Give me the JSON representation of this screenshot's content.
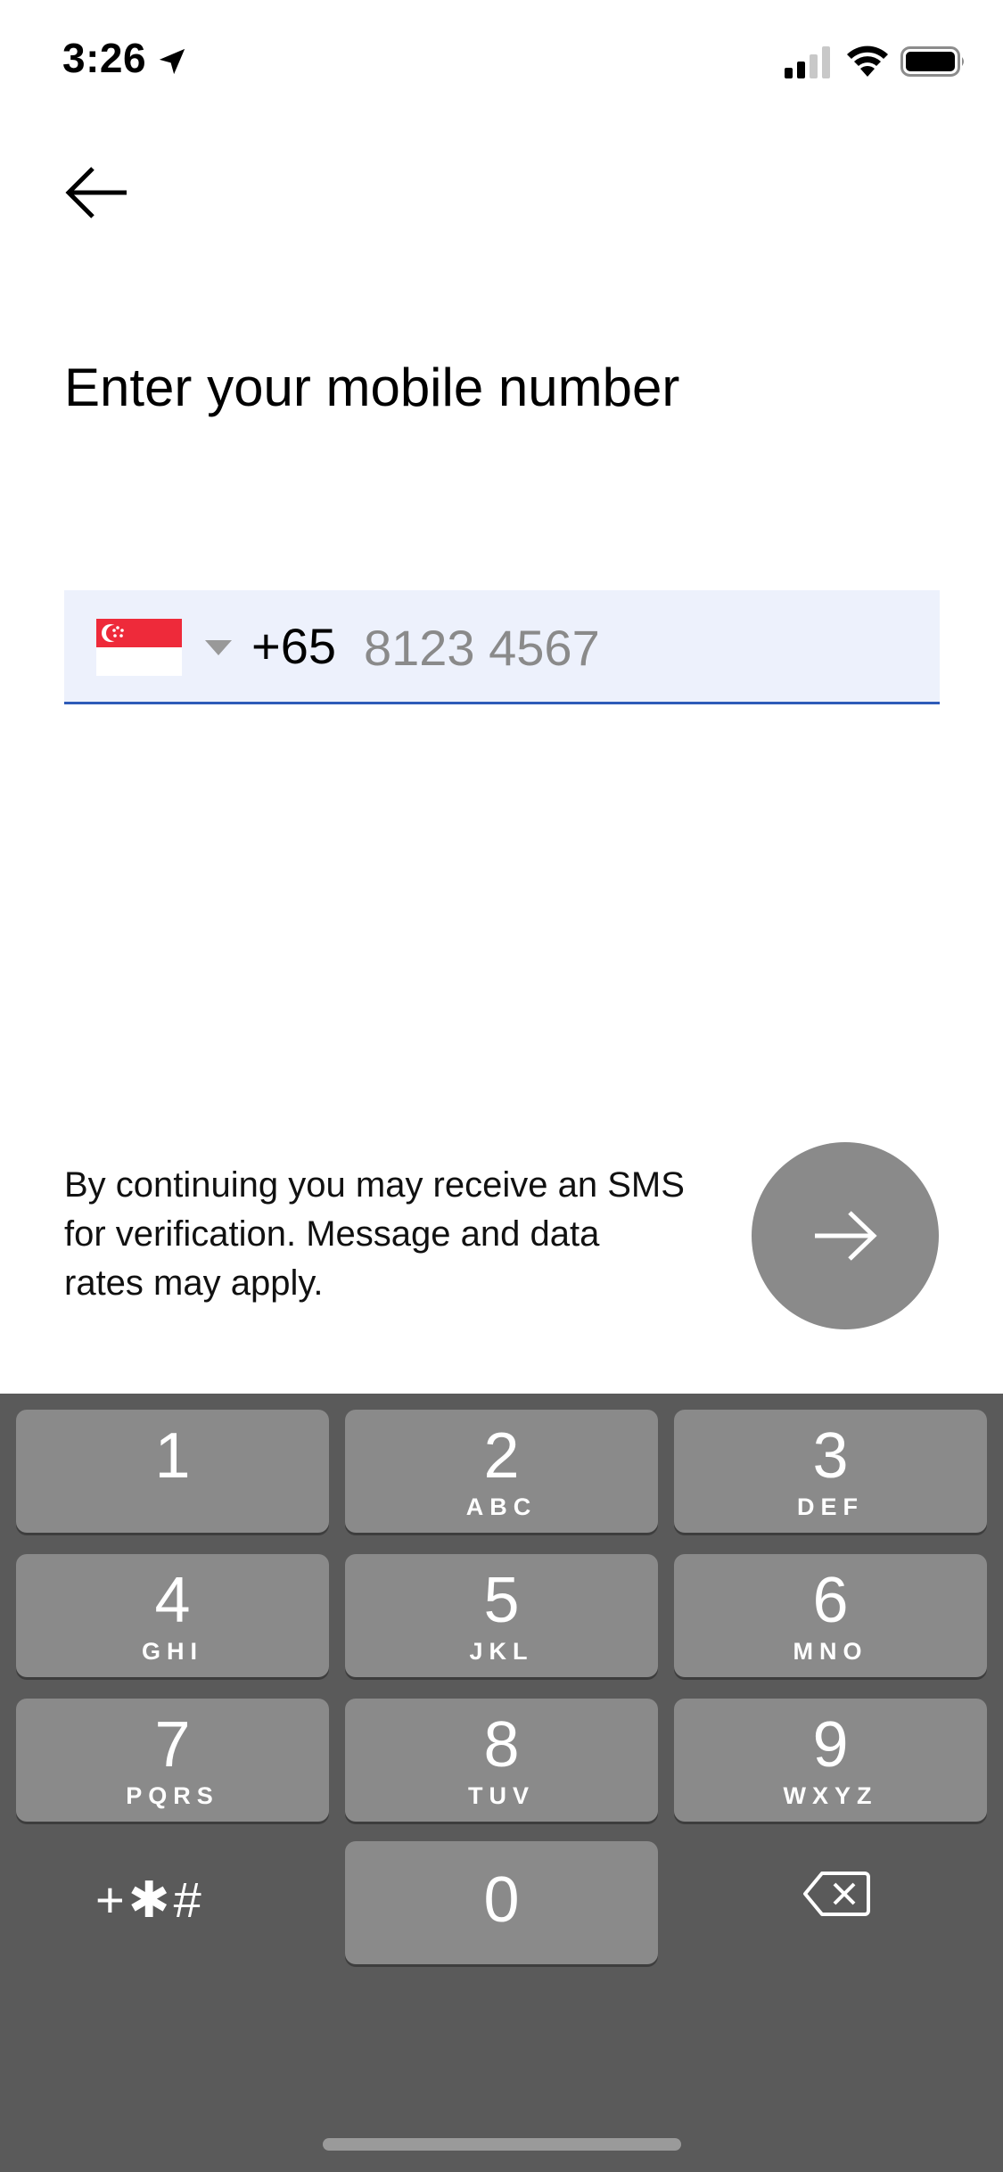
{
  "status_bar": {
    "time": "3:26",
    "icons": [
      "location-arrow-icon",
      "cellular-signal-icon",
      "wifi-icon",
      "battery-icon"
    ]
  },
  "header": {
    "back_icon": "arrow-left-icon",
    "title": "Enter your mobile number"
  },
  "phone_input": {
    "country_flag": "singapore-flag-icon",
    "dial_code": "+65",
    "placeholder": "8123 4567",
    "value": ""
  },
  "disclaimer": "By continuing you may receive an SMS for verification. Message and data rates may apply.",
  "next_button_icon": "arrow-right-icon",
  "keypad": {
    "keys": [
      {
        "digit": "1",
        "letters": ""
      },
      {
        "digit": "2",
        "letters": "ABC"
      },
      {
        "digit": "3",
        "letters": "DEF"
      },
      {
        "digit": "4",
        "letters": "GHI"
      },
      {
        "digit": "5",
        "letters": "JKL"
      },
      {
        "digit": "6",
        "letters": "MNO"
      },
      {
        "digit": "7",
        "letters": "PQRS"
      },
      {
        "digit": "8",
        "letters": "TUV"
      },
      {
        "digit": "9",
        "letters": "WXYZ"
      },
      {
        "digit": "0",
        "letters": ""
      }
    ],
    "symbols_label": "+✱#",
    "delete_icon": "backspace-icon"
  },
  "colors": {
    "input_background": "#edf1fc",
    "input_underline": "#2e5bb8",
    "next_button": "#8a8a8a",
    "keypad_background": "#5a5a5a",
    "key_background": "#8a8a8a",
    "flag_red": "#ee2a3a"
  }
}
